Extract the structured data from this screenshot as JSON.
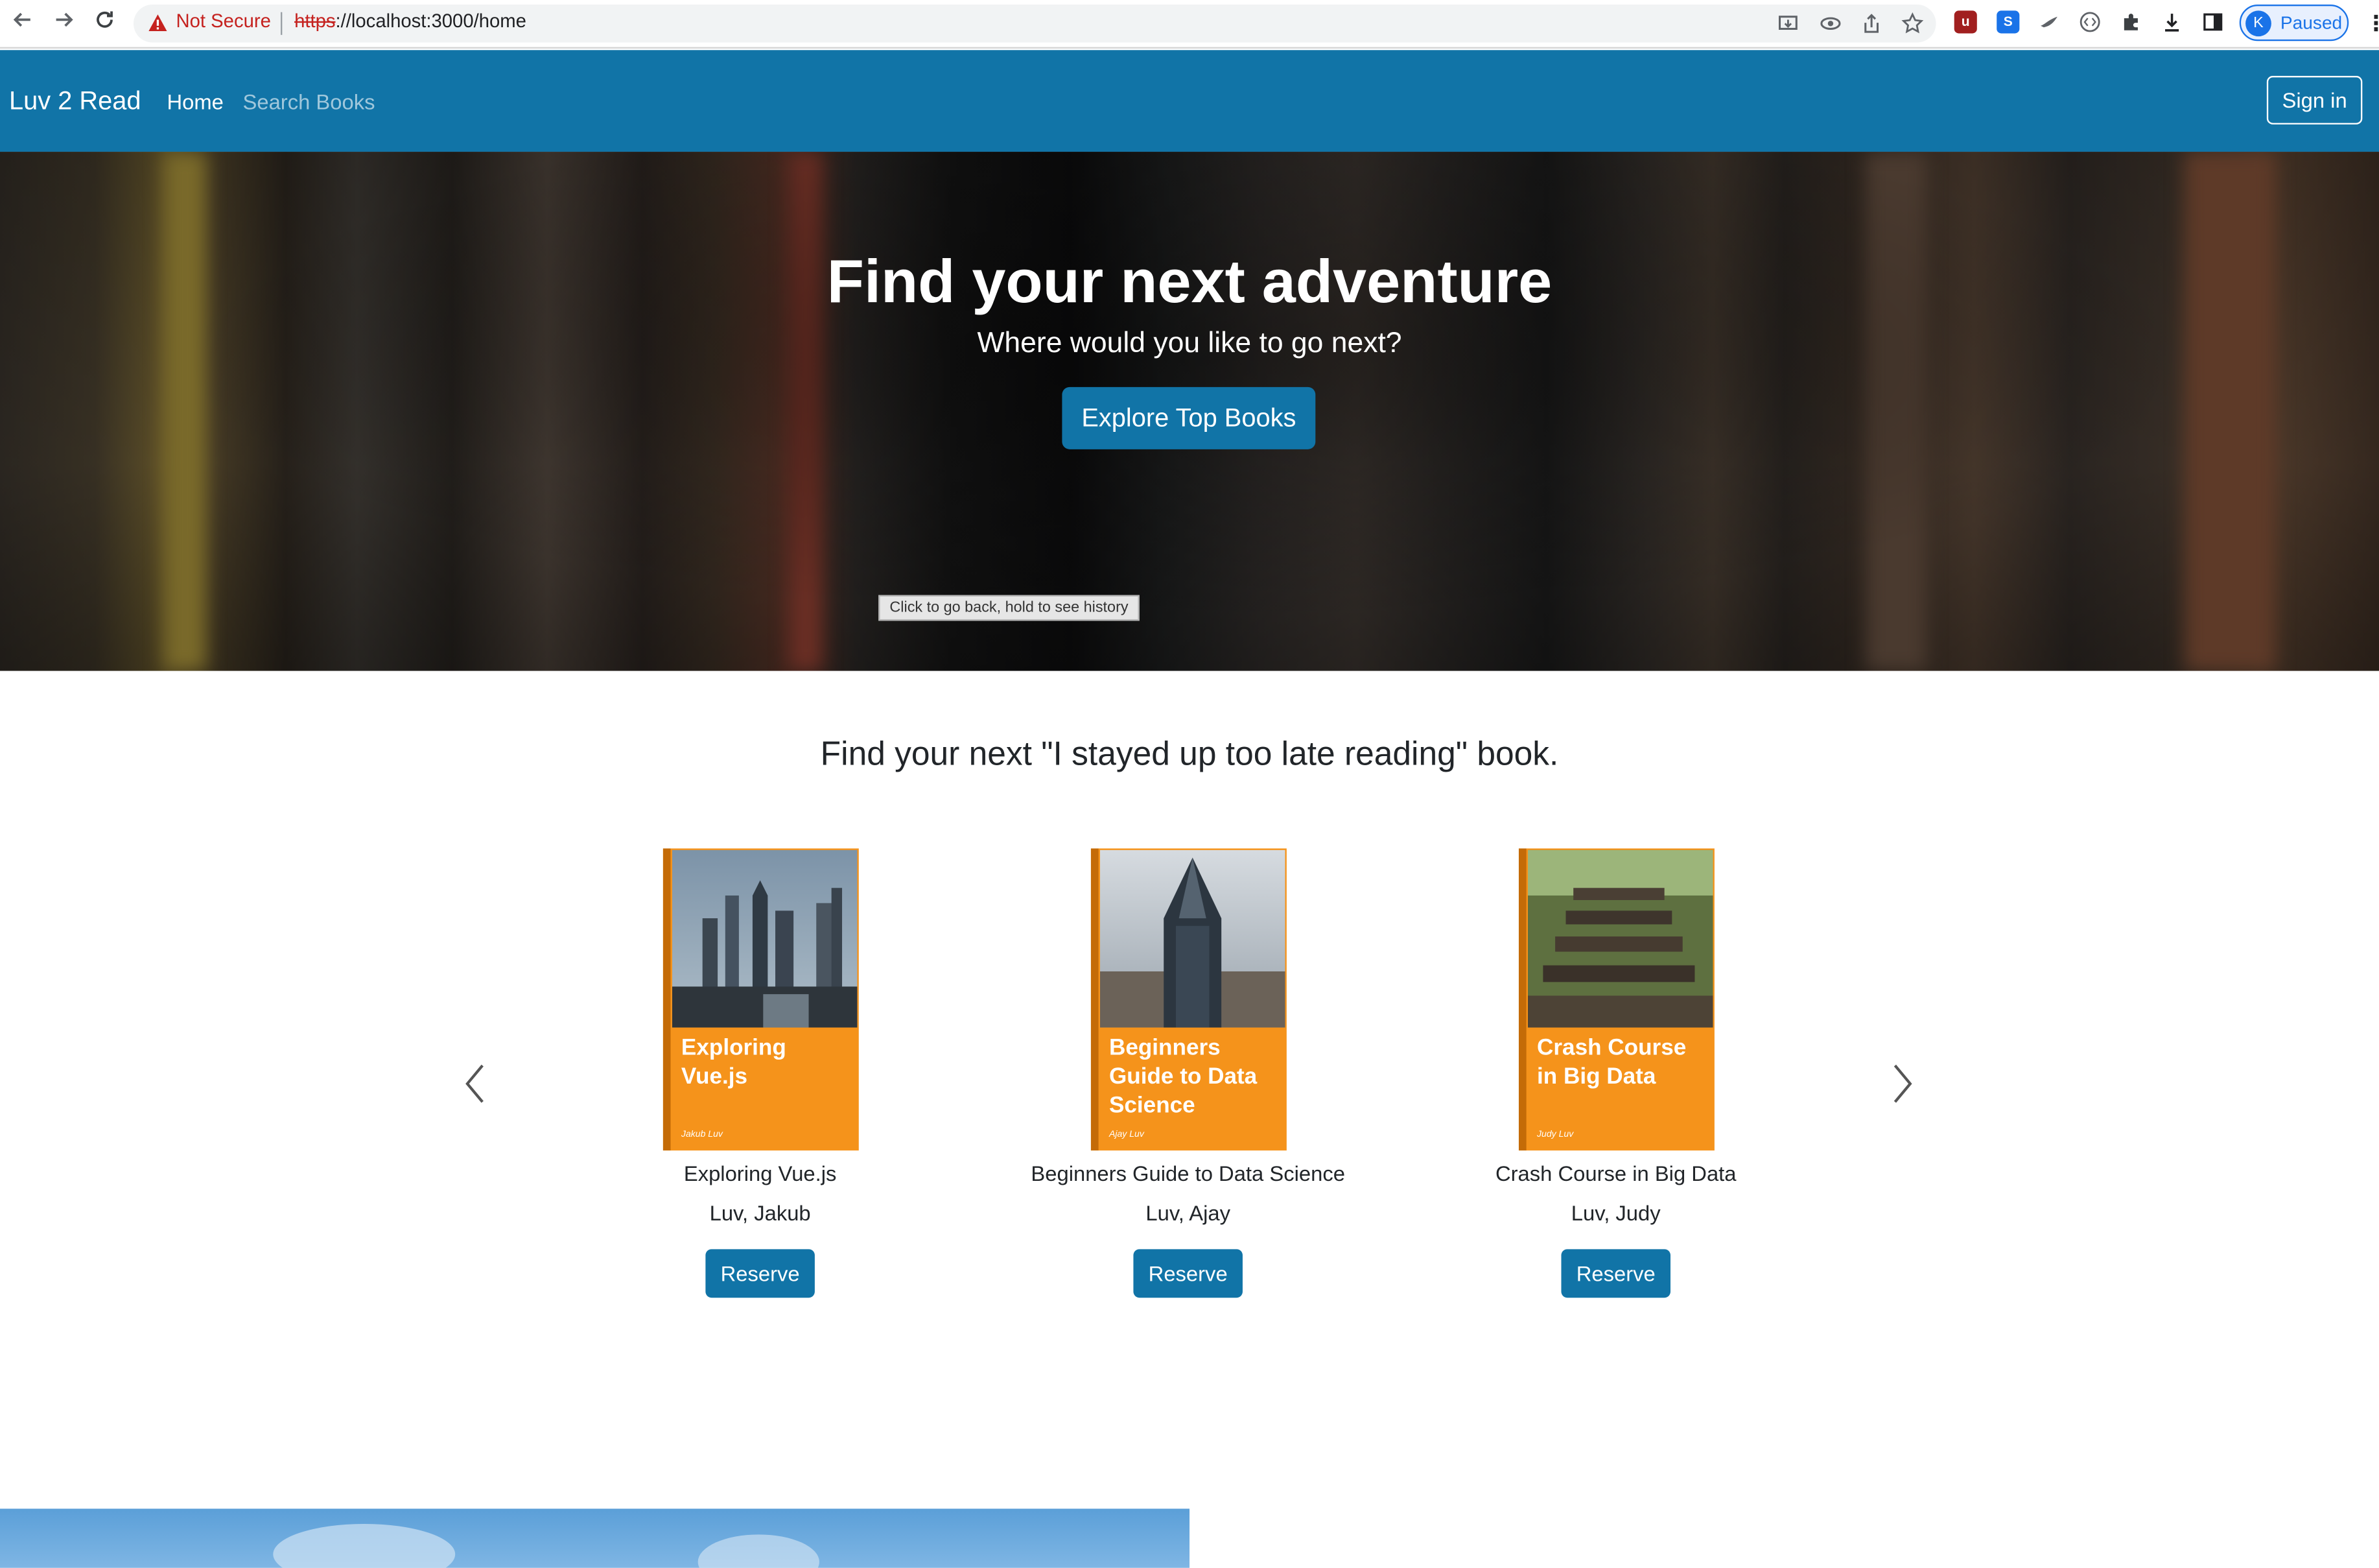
{
  "browser": {
    "security_label": "Not Secure",
    "url_scheme": "https",
    "url_rest": "://localhost:3000/home",
    "profile_initial": "K",
    "profile_status": "Paused"
  },
  "navbar": {
    "brand": "Luv 2 Read",
    "links": [
      "Home",
      "Search Books"
    ],
    "signin_label": "Sign in",
    "color": "#1174a7"
  },
  "hero": {
    "title": "Find your next adventure",
    "subtitle": "Where would you like to go next?",
    "button_label": "Explore Top Books",
    "tooltip": "Click to go back, hold to see history"
  },
  "carousel": {
    "heading": "Find your next \"I stayed up too late reading\" book.",
    "books": [
      {
        "cover_title": "Exploring Vue.js",
        "cover_author": "Jakub Luv",
        "title": "Exploring Vue.js",
        "author": "Luv, Jakub",
        "button": "Reserve"
      },
      {
        "cover_title": "Beginners Guide to Data Science",
        "cover_author": "Ajay Luv",
        "title": "Beginners Guide to Data Science",
        "author": "Luv, Ajay",
        "button": "Reserve"
      },
      {
        "cover_title": "Crash Course in Big Data",
        "cover_author": "Judy Luv",
        "title": "Crash Course in Big Data",
        "author": "Luv, Judy",
        "button": "Reserve"
      }
    ],
    "cover_color": "#f5931b"
  }
}
